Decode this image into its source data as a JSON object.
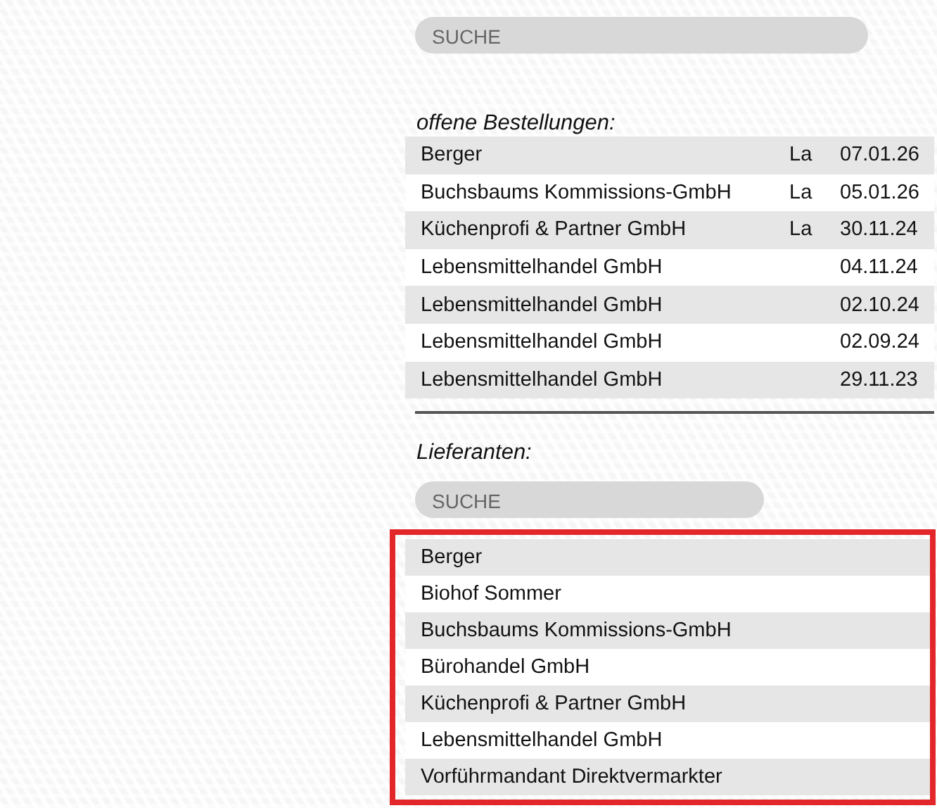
{
  "orders_search": {
    "placeholder": "SUCHE"
  },
  "orders": {
    "heading": "offene Bestellungen:",
    "rows": [
      {
        "name": "Berger",
        "column_2": "La",
        "date": "07.01.26"
      },
      {
        "name": "Buchsbaums Kommissions-GmbH",
        "column_2": "La",
        "date": "05.01.26"
      },
      {
        "name": "Küchenprofi & Partner GmbH",
        "column_2": "La",
        "date": "30.11.24"
      },
      {
        "name": "Lebensmittelhandel GmbH",
        "date": "04.11.24"
      },
      {
        "name": "Lebensmittelhandel GmbH",
        "date": "02.10.24"
      },
      {
        "name": "Lebensmittelhandel GmbH",
        "date": "02.09.24"
      },
      {
        "name": "Lebensmittelhandel GmbH",
        "date": "29.11.23"
      }
    ]
  },
  "suppliers": {
    "heading": "Lieferanten:",
    "search": {
      "placeholder": "SUCHE"
    },
    "highlighted": true,
    "items": [
      {
        "name": "Berger"
      },
      {
        "name": "Biohof Sommer"
      },
      {
        "name": "Buchsbaums Kommissions-GmbH"
      },
      {
        "name": "Bürohandel GmbH"
      },
      {
        "name": "Küchenprofi & Partner GmbH"
      },
      {
        "name": "Lebensmittelhandel GmbH"
      },
      {
        "name": "Vorführmandant Direktvermarkter"
      }
    ]
  }
}
